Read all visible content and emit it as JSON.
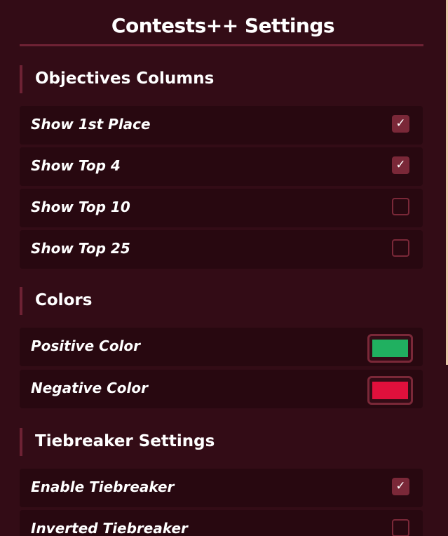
{
  "title": "Contests++ Settings",
  "sections": {
    "objectives": {
      "label": "Objectives Columns",
      "items": [
        {
          "label": "Show 1st Place",
          "checked": true
        },
        {
          "label": "Show Top 4",
          "checked": true
        },
        {
          "label": "Show Top 10",
          "checked": false
        },
        {
          "label": "Show Top 25",
          "checked": false
        }
      ]
    },
    "colors": {
      "label": "Colors",
      "items": [
        {
          "label": "Positive Color",
          "color": "#20b060"
        },
        {
          "label": "Negative Color",
          "color": "#e0103c"
        }
      ]
    },
    "tiebreaker": {
      "label": "Tiebreaker Settings",
      "items": [
        {
          "label": "Enable Tiebreaker",
          "checked": true
        },
        {
          "label": "Inverted Tiebreaker",
          "checked": false
        }
      ]
    }
  },
  "check_glyph": "✓"
}
